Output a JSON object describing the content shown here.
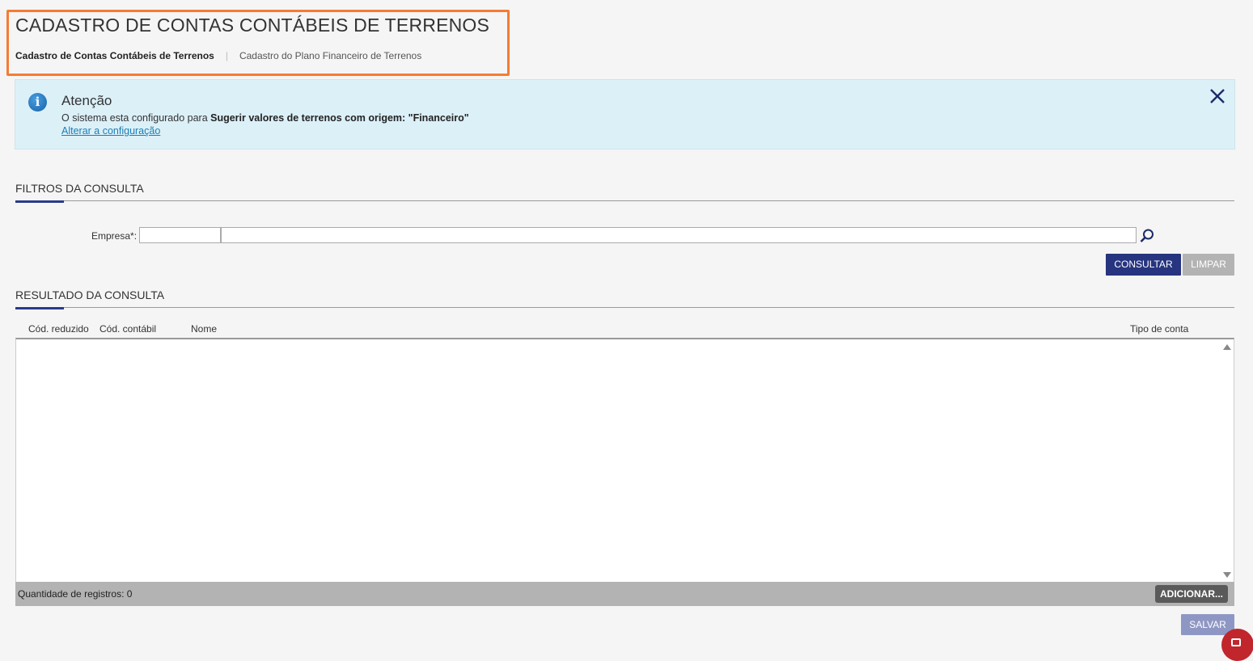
{
  "page": {
    "title": "CADASTRO DE CONTAS CONTÁBEIS DE TERRENOS",
    "tabs": [
      {
        "label": "Cadastro de Contas Contábeis de Terrenos",
        "active": true
      },
      {
        "label": "Cadastro do Plano Financeiro de Terrenos",
        "active": false
      }
    ],
    "tab_separator": "|"
  },
  "alert": {
    "icon": "info-icon",
    "icon_glyph": "i",
    "title": "Atenção",
    "message_prefix": "O sistema esta configurado para ",
    "message_bold": "Sugerir valores de terrenos com origem: \"Financeiro\"",
    "link": "Alterar a configuração",
    "close_icon": "close-icon"
  },
  "filters": {
    "title": "FILTROS DA CONSULTA",
    "empresa_label": "Empresa*:",
    "empresa_code": "",
    "empresa_name": "",
    "search_icon": "search-icon",
    "consultar_label": "CONSULTAR",
    "limpar_label": "LIMPAR"
  },
  "results": {
    "title": "RESULTADO DA CONSULTA",
    "columns": [
      "Cód. reduzido",
      "Cód. contábil",
      "Nome",
      "Tipo de conta"
    ],
    "rows": [],
    "records_text": "Quantidade de registros: 0",
    "adicionar_label": "ADICIONAR..."
  },
  "footer": {
    "salvar_label": "SALVAR"
  },
  "colors": {
    "accent": "#2b3a8c",
    "highlight_border": "#f57c33",
    "alert_bg": "#dcf0f8",
    "fab": "#c0262c"
  }
}
